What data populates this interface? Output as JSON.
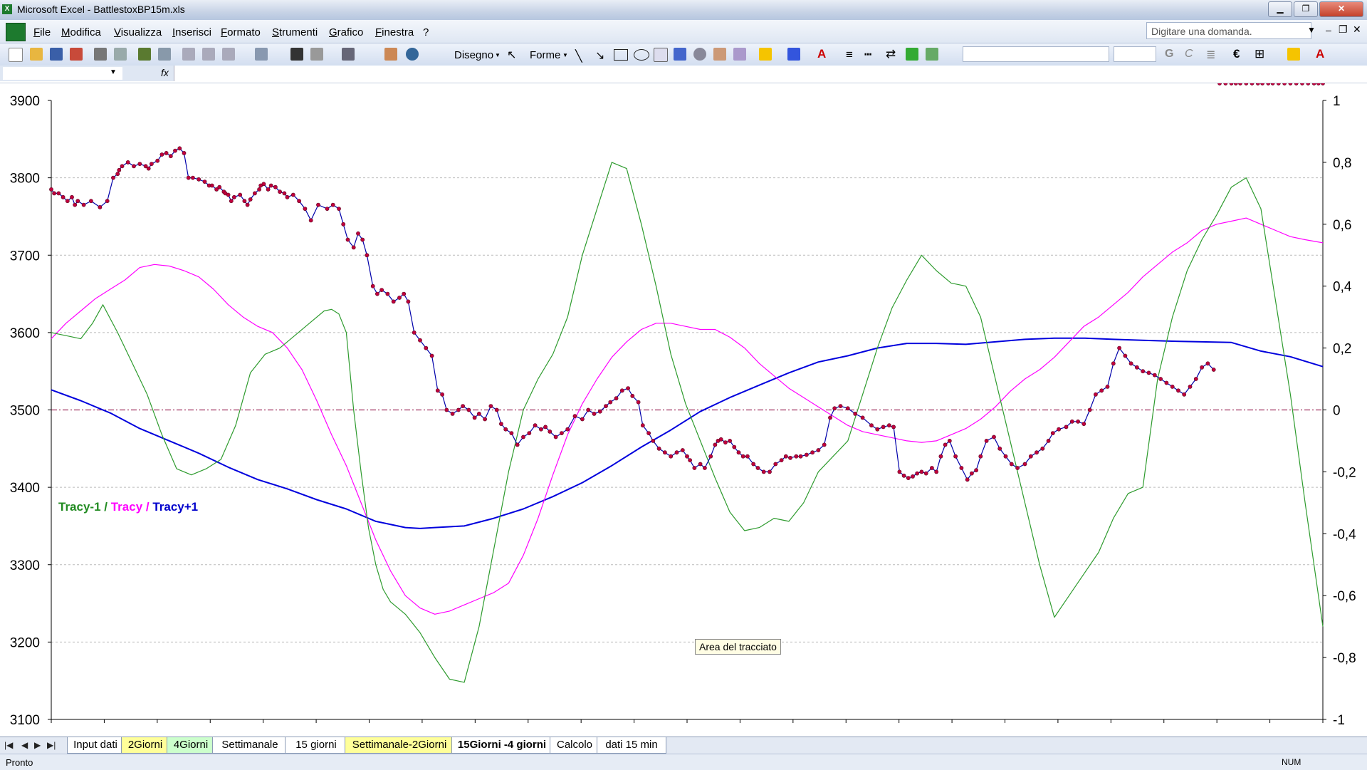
{
  "window": {
    "title": "Microsoft Excel - BattlestoxBP15m.xls"
  },
  "menu": {
    "items": [
      "File",
      "Modifica",
      "Visualizza",
      "Inserisci",
      "Formato",
      "Strumenti",
      "Grafico",
      "Finestra",
      "?"
    ],
    "help_placeholder": "Digitare una domanda."
  },
  "toolbar": {
    "disegno": "Disegno",
    "forme": "Forme",
    "fx": "fx"
  },
  "chart_data": {
    "type": "line",
    "y_left": {
      "min": 3100,
      "max": 3900,
      "ticks": [
        "3900",
        "3800",
        "3700",
        "3600",
        "3500",
        "3400",
        "3300",
        "3200",
        "3100"
      ]
    },
    "y_right": {
      "min": -1,
      "max": 1,
      "ticks": [
        "1",
        "0,8",
        "0,6",
        "0,4",
        "0,2",
        "0",
        "-0,2",
        "-0,4",
        "-0,6",
        "-0,8",
        "-1"
      ]
    },
    "legend_parts": [
      {
        "text": "Tracy-1",
        "color": "#228B22"
      },
      {
        "text": " / ",
        "color": "#228B22"
      },
      {
        "text": "Tracy",
        "color": "#ff00ff"
      },
      {
        "text": " / ",
        "color": "#ff00ff"
      },
      {
        "text": "Tracy+1",
        "color": "#0000cc"
      }
    ],
    "price_series": {
      "name": "",
      "color": "#0000aa",
      "marker_color": "#c0003c",
      "axis": "left",
      "x": [
        0,
        2,
        5,
        8,
        11,
        14,
        16,
        18,
        22,
        27,
        33,
        38,
        42,
        45,
        46,
        48,
        52,
        56,
        60,
        64,
        66,
        68,
        72,
        75,
        78,
        81,
        84,
        87,
        90,
        93,
        96,
        100,
        104,
        107,
        109,
        112,
        114,
        117,
        118,
        120,
        122,
        124,
        128,
        131,
        133,
        135,
        138,
        141,
        142,
        144,
        147,
        149,
        152,
        155,
        158,
        160,
        164,
        168,
        172,
        176,
        181,
        187,
        191,
        195,
        198,
        201,
        205,
        208,
        211,
        214,
        218,
        221,
        224,
        228,
        232,
        236,
        239,
        242,
        246,
        250,
        254,
        258,
        262,
        265,
        268,
        272,
        276,
        279,
        283,
        287,
        290,
        294,
        298,
        302,
        305,
        308,
        312,
        316,
        320,
        324,
        328,
        332,
        335,
        338,
        342,
        346,
        350,
        355,
        360,
        364,
        368,
        372,
        376,
        379,
        383,
        387,
        391,
        394,
        398,
        401,
        405,
        408,
        412,
        416,
        420,
        424,
        428,
        431,
        433,
        436,
        440,
        443,
        447,
        450,
        452,
        454,
        457,
        460,
        463,
        466,
        469,
        472,
        476,
        479,
        483,
        487,
        491,
        495,
        498,
        501,
        505,
        508,
        512,
        516,
        520,
        524,
        528,
        531,
        535,
        540,
        545,
        550,
        556,
        560,
        564,
        568,
        571,
        575,
        578,
        581,
        584,
        587,
        590,
        593,
        597,
        600,
        603,
        606,
        609,
        613,
        617,
        621,
        624,
        627,
        630,
        634,
        639,
        643,
        647,
        651,
        655,
        660,
        664,
        668,
        672,
        676,
        679,
        683,
        688,
        692,
        696,
        700,
        704,
        708,
        712,
        716,
        720,
        724,
        728,
        732,
        736,
        740,
        744,
        748,
        752,
        756,
        760,
        764,
        768,
        772,
        776,
        780,
        784,
        788,
        792,
        796,
        800,
        803,
        806,
        810,
        814,
        818,
        821,
        825,
        828,
        832,
        836,
        840,
        844,
        848,
        852,
        856,
        859,
        862
      ],
      "y": [
        3785,
        3780,
        3780,
        3775,
        3770,
        3775,
        3765,
        3770,
        3765,
        3770,
        3762,
        3770,
        3800,
        3805,
        3810,
        3815,
        3820,
        3815,
        3818,
        3815,
        3812,
        3818,
        3822,
        3830,
        3832,
        3828,
        3835,
        3838,
        3832,
        3800,
        3800,
        3798,
        3795,
        3790,
        3790,
        3785,
        3788,
        3782,
        3780,
        3778,
        3770,
        3775,
        3778,
        3770,
        3765,
        3772,
        3780,
        3785,
        3790,
        3792,
        3785,
        3790,
        3788,
        3782,
        3780,
        3775,
        3778,
        3770,
        3760,
        3745,
        3765,
        3760,
        3765,
        3760,
        3740,
        3720,
        3710,
        3728,
        3720,
        3700,
        3660,
        3650,
        3655,
        3650,
        3640,
        3645,
        3650,
        3640,
        3600,
        3590,
        3580,
        3570,
        3525,
        3520,
        3500,
        3495,
        3500,
        3505,
        3500,
        3490,
        3495,
        3488,
        3505,
        3500,
        3482,
        3475,
        3470,
        3455,
        3465,
        3470,
        3480,
        3475,
        3478,
        3472,
        3465,
        3470,
        3475,
        3492,
        3488,
        3500,
        3495,
        3498,
        3505,
        3510,
        3515,
        3525,
        3528,
        3518,
        3510,
        3480,
        3470,
        3460,
        3450,
        3445,
        3440,
        3445,
        3448,
        3440,
        3435,
        3425,
        3430,
        3425,
        3440,
        3455,
        3460,
        3462,
        3458,
        3460,
        3452,
        3445,
        3440,
        3440,
        3430,
        3425,
        3420,
        3420,
        3430,
        3435,
        3440,
        3438,
        3440,
        3440,
        3442,
        3445,
        3448,
        3455,
        3490,
        3502,
        3505,
        3502,
        3495,
        3490,
        3480,
        3475,
        3478,
        3480,
        3478,
        3420,
        3415,
        3412,
        3414,
        3418,
        3420,
        3418,
        3425,
        3420,
        3440,
        3455,
        3460,
        3440,
        3425,
        3410,
        3418,
        3422,
        3440,
        3460,
        3465,
        3450,
        3440,
        3430,
        3425,
        3430,
        3440,
        3445,
        3450,
        3460,
        3470,
        3475,
        3478,
        3485,
        3485,
        3482,
        3500,
        3520,
        3525,
        3530,
        3560,
        3580,
        3570,
        3560,
        3555,
        3550,
        3548,
        3545,
        3540,
        3535,
        3530,
        3525,
        3520,
        3530,
        3540,
        3555,
        3560,
        3552
      ],
      "x_max": 862
    },
    "series": [
      {
        "name": "Tracy+1",
        "color": "#0000dd",
        "width": 2,
        "axis": "right",
        "x": [
          0,
          20,
          40,
          60,
          80,
          100,
          120,
          140,
          160,
          180,
          200,
          220,
          240,
          250,
          260,
          280,
          300,
          320,
          340,
          360,
          380,
          400,
          420,
          440,
          460,
          480,
          500,
          520,
          540,
          560,
          580,
          600,
          620,
          640,
          660,
          680,
          700,
          720,
          740,
          760,
          780,
          800,
          820,
          840,
          862
        ],
        "y": [
          0.065,
          0.03,
          -0.01,
          -0.06,
          -0.1,
          -0.14,
          -0.185,
          -0.225,
          -0.255,
          -0.29,
          -0.32,
          -0.36,
          -0.38,
          -0.383,
          -0.38,
          -0.375,
          -0.35,
          -0.32,
          -0.28,
          -0.235,
          -0.18,
          -0.12,
          -0.065,
          -0.005,
          0.04,
          0.08,
          0.12,
          0.155,
          0.175,
          0.2,
          0.215,
          0.215,
          0.212,
          0.22,
          0.228,
          0.232,
          0.232,
          0.228,
          0.225,
          0.222,
          0.22,
          0.218,
          0.19,
          0.172,
          0.14
        ]
      },
      {
        "name": "Tracy",
        "color": "#ff00ff",
        "width": 1.2,
        "axis": "right",
        "x": [
          0,
          10,
          20,
          30,
          40,
          50,
          60,
          70,
          80,
          90,
          100,
          110,
          120,
          130,
          140,
          150,
          160,
          170,
          180,
          190,
          200,
          210,
          220,
          230,
          240,
          250,
          260,
          270,
          280,
          290,
          300,
          310,
          320,
          330,
          340,
          350,
          360,
          370,
          380,
          390,
          400,
          410,
          420,
          430,
          440,
          450,
          460,
          470,
          480,
          490,
          500,
          510,
          520,
          530,
          540,
          550,
          560,
          570,
          580,
          590,
          600,
          610,
          620,
          630,
          640,
          650,
          660,
          670,
          680,
          690,
          700,
          710,
          720,
          730,
          740,
          750,
          760,
          770,
          780,
          790,
          800,
          810,
          820,
          830,
          840,
          850,
          862
        ],
        "y": [
          0.23,
          0.28,
          0.32,
          0.36,
          0.39,
          0.42,
          0.46,
          0.47,
          0.465,
          0.45,
          0.43,
          0.39,
          0.34,
          0.3,
          0.27,
          0.25,
          0.2,
          0.13,
          0.03,
          -0.08,
          -0.18,
          -0.3,
          -0.42,
          -0.52,
          -0.6,
          -0.64,
          -0.66,
          -0.65,
          -0.63,
          -0.61,
          -0.59,
          -0.56,
          -0.47,
          -0.35,
          -0.21,
          -0.08,
          0.02,
          0.1,
          0.17,
          0.22,
          0.26,
          0.28,
          0.28,
          0.27,
          0.26,
          0.26,
          0.235,
          0.2,
          0.15,
          0.11,
          0.07,
          0.04,
          0.01,
          -0.02,
          -0.05,
          -0.07,
          -0.08,
          -0.09,
          -0.1,
          -0.105,
          -0.1,
          -0.08,
          -0.06,
          -0.03,
          0.01,
          0.06,
          0.1,
          0.13,
          0.17,
          0.22,
          0.27,
          0.3,
          0.34,
          0.38,
          0.43,
          0.47,
          0.51,
          0.54,
          0.58,
          0.6,
          0.61,
          0.62,
          0.6,
          0.58,
          0.56,
          0.55,
          0.54
        ]
      },
      {
        "name": "Tracy-1",
        "color": "#2e9b2e",
        "width": 1.2,
        "axis": "right",
        "x": [
          0,
          10,
          20,
          28,
          35,
          45,
          55,
          65,
          75,
          85,
          95,
          105,
          115,
          125,
          135,
          145,
          155,
          165,
          175,
          185,
          190,
          195,
          200,
          205,
          210,
          215,
          220,
          225,
          230,
          240,
          250,
          260,
          270,
          280,
          290,
          300,
          310,
          320,
          330,
          340,
          350,
          360,
          370,
          380,
          390,
          400,
          410,
          420,
          430,
          440,
          450,
          460,
          470,
          480,
          490,
          500,
          510,
          520,
          530,
          540,
          550,
          560,
          570,
          580,
          590,
          600,
          610,
          620,
          630,
          640,
          650,
          660,
          670,
          680,
          690,
          700,
          710,
          720,
          730,
          740,
          750,
          760,
          770,
          780,
          790,
          800,
          810,
          820,
          830,
          840,
          850,
          862
        ],
        "y": [
          0.25,
          0.24,
          0.23,
          0.28,
          0.34,
          0.25,
          0.15,
          0.05,
          -0.08,
          -0.19,
          -0.21,
          -0.19,
          -0.16,
          -0.05,
          0.12,
          0.18,
          0.2,
          0.24,
          0.28,
          0.32,
          0.325,
          0.31,
          0.25,
          0.0,
          -0.2,
          -0.38,
          -0.5,
          -0.58,
          -0.62,
          -0.66,
          -0.72,
          -0.8,
          -0.87,
          -0.88,
          -0.7,
          -0.45,
          -0.2,
          0.0,
          0.1,
          0.18,
          0.3,
          0.5,
          0.65,
          0.8,
          0.78,
          0.6,
          0.4,
          0.18,
          0.02,
          -0.1,
          -0.22,
          -0.33,
          -0.39,
          -0.38,
          -0.35,
          -0.36,
          -0.3,
          -0.2,
          -0.15,
          -0.1,
          0.05,
          0.2,
          0.33,
          0.42,
          0.5,
          0.45,
          0.41,
          0.4,
          0.3,
          0.1,
          -0.1,
          -0.3,
          -0.5,
          -0.67,
          -0.6,
          -0.53,
          -0.46,
          -0.35,
          -0.27,
          -0.25,
          0.1,
          0.3,
          0.45,
          0.55,
          0.63,
          0.72,
          0.75,
          0.65,
          0.35,
          0.05,
          -0.3,
          -0.7
        ]
      }
    ]
  },
  "tooltip": "Area del tracciato",
  "sheet_tabs": [
    {
      "label": "Input dati",
      "color": "#ffffff"
    },
    {
      "label": "2Giorni",
      "color": "#ffff99"
    },
    {
      "label": "4Giorni",
      "color": "#ccffcc"
    },
    {
      "label": "Settimanale",
      "color": "#ffffff"
    },
    {
      "label": "15 giorni",
      "color": "#ffffff"
    },
    {
      "label": "Settimanale-2Giorni",
      "color": "#ffff99"
    },
    {
      "label": "15Giorni -4 giorni",
      "color": "#ffffff",
      "active": true
    },
    {
      "label": "Calcolo",
      "color": "#ffffff"
    },
    {
      "label": "dati 15 min",
      "color": "#ffffff"
    }
  ],
  "status": {
    "left": "Pronto",
    "num": "NUM"
  }
}
